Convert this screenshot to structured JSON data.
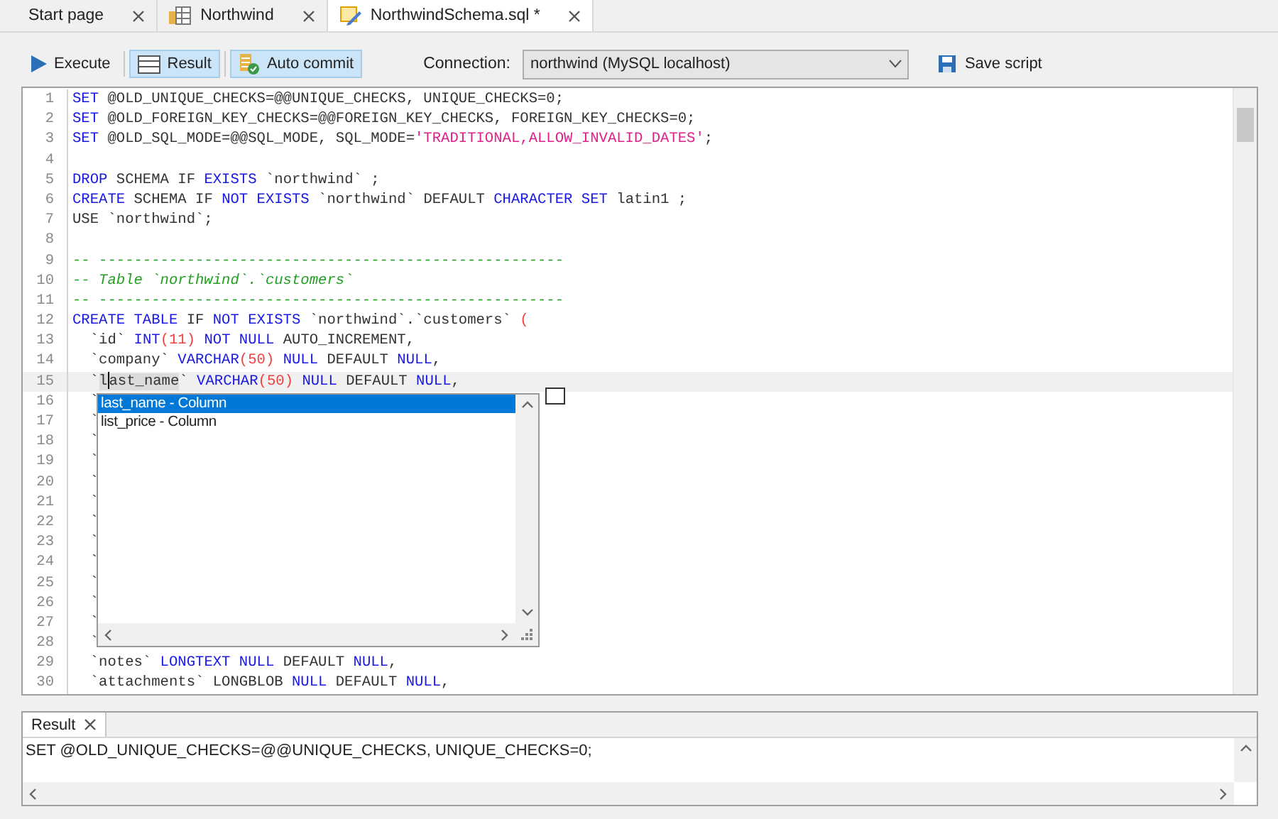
{
  "tabs": [
    {
      "label": "Start page",
      "kind": "page",
      "selected": false
    },
    {
      "label": "Northwind",
      "kind": "database",
      "selected": false
    },
    {
      "label": "NorthwindSchema.sql *",
      "kind": "script",
      "selected": true
    }
  ],
  "toolbar": {
    "buttons": [
      {
        "label": "Execute",
        "kind": "execute",
        "pressed": false
      },
      {
        "label": "Result",
        "kind": "result",
        "pressed": true
      },
      {
        "label": "Auto commit",
        "kind": "commit",
        "pressed": true
      }
    ],
    "connection": {
      "label": "Connection:",
      "value": "northwind (MySQL localhost)"
    },
    "save": {
      "label": "Save script"
    }
  },
  "editor": {
    "lines": [
      {
        "number": "1",
        "current": false,
        "tokens": [
          {
            "t": "SET",
            "kind": "kw"
          },
          {
            "t": " @OLD_UNIQUE_CHECKS=@@UNIQUE_CHECKS, UNIQUE_CHECKS=0;",
            "kind": "id"
          }
        ]
      },
      {
        "number": "2",
        "current": false,
        "tokens": [
          {
            "t": "SET",
            "kind": "kw"
          },
          {
            "t": " @OLD_FOREIGN_KEY_CHECKS=@@FOREIGN_KEY_CHECKS, FOREIGN_KEY_CHECKS=0;",
            "kind": "id"
          }
        ]
      },
      {
        "number": "3",
        "current": false,
        "tokens": [
          {
            "t": "SET",
            "kind": "kw"
          },
          {
            "t": " @OLD_SQL_MODE=@@SQL_MODE, SQL_MODE=",
            "kind": "id"
          },
          {
            "t": "'TRADITIONAL,ALLOW_INVALID_DATES'",
            "kind": "str"
          },
          {
            "t": ";",
            "kind": "id"
          }
        ]
      },
      {
        "number": "4",
        "current": false
      },
      {
        "number": "5",
        "current": false,
        "tokens": [
          {
            "t": "DROP",
            "kind": "kw"
          },
          {
            "t": " SCHEMA IF ",
            "kind": "id"
          },
          {
            "t": "EXISTS",
            "kind": "kw"
          },
          {
            "t": " `northwind` ;",
            "kind": "id"
          }
        ]
      },
      {
        "number": "6",
        "current": false,
        "tokens": [
          {
            "t": "CREATE",
            "kind": "kw"
          },
          {
            "t": " SCHEMA IF ",
            "kind": "id"
          },
          {
            "t": "NOT EXISTS",
            "kind": "kw"
          },
          {
            "t": " `northwind` DEFAULT ",
            "kind": "id"
          },
          {
            "t": "CHARACTER SET",
            "kind": "kw"
          },
          {
            "t": " latin1 ;",
            "kind": "id"
          }
        ]
      },
      {
        "number": "7",
        "current": false,
        "tokens": [
          {
            "t": "USE `northwind`;",
            "kind": "id"
          }
        ]
      },
      {
        "number": "8",
        "current": false
      },
      {
        "number": "9",
        "current": false,
        "tokens": [
          {
            "t": "-- -----------------------------------------------------",
            "kind": "cmt"
          }
        ]
      },
      {
        "number": "10",
        "current": false,
        "tokens": [
          {
            "t": "-- Table `northwind`.`customers`",
            "kind": "cmt"
          }
        ]
      },
      {
        "number": "11",
        "current": false,
        "tokens": [
          {
            "t": "-- -----------------------------------------------------",
            "kind": "cmt"
          }
        ]
      },
      {
        "number": "12",
        "current": false,
        "tokens": [
          {
            "t": "CREATE TABLE",
            "kind": "kw"
          },
          {
            "t": " IF ",
            "kind": "id"
          },
          {
            "t": "NOT EXISTS",
            "kind": "kw"
          },
          {
            "t": " `northwind`.`customers` ",
            "kind": "id"
          },
          {
            "t": "(",
            "kind": "num"
          }
        ]
      },
      {
        "number": "13",
        "current": false,
        "tokens": [
          {
            "t": "  `id` ",
            "kind": "id"
          },
          {
            "t": "INT",
            "kind": "kw"
          },
          {
            "t": "(11)",
            "kind": "num"
          },
          {
            "t": " NOT NULL",
            "kind": "kw"
          },
          {
            "t": " AUTO_INCREMENT,",
            "kind": "id"
          }
        ]
      },
      {
        "number": "14",
        "current": false,
        "tokens": [
          {
            "t": "  `company` ",
            "kind": "id"
          },
          {
            "t": "VARCHAR",
            "kind": "kw"
          },
          {
            "t": "(50)",
            "kind": "num"
          },
          {
            "t": " NULL",
            "kind": "kw"
          },
          {
            "t": " DEFAULT ",
            "kind": "id"
          },
          {
            "t": "NULL",
            "kind": "kw"
          },
          {
            "t": ",",
            "kind": "id"
          }
        ]
      },
      {
        "number": "15",
        "current": true,
        "tokens": [
          {
            "t": "  `",
            "kind": "id"
          },
          {
            "t": "last_name",
            "kind": "match"
          },
          {
            "t": "` ",
            "kind": "id"
          },
          {
            "t": "VARCHAR",
            "kind": "kw"
          },
          {
            "t": "(50)",
            "kind": "num"
          },
          {
            "t": " NULL",
            "kind": "kw"
          },
          {
            "t": " DEFAULT ",
            "kind": "id"
          },
          {
            "t": "NULL",
            "kind": "kw"
          },
          {
            "t": ",",
            "kind": "id"
          }
        ]
      },
      {
        "number": "16",
        "current": false,
        "tokens": [
          {
            "t": "  `",
            "kind": "id"
          }
        ]
      },
      {
        "number": "17",
        "current": false,
        "tokens": [
          {
            "t": "  `",
            "kind": "id"
          }
        ]
      },
      {
        "number": "18",
        "current": false,
        "tokens": [
          {
            "t": "  `",
            "kind": "id"
          }
        ]
      },
      {
        "number": "19",
        "current": false,
        "tokens": [
          {
            "t": "  `",
            "kind": "id"
          }
        ]
      },
      {
        "number": "20",
        "current": false,
        "tokens": [
          {
            "t": "  `",
            "kind": "id"
          }
        ]
      },
      {
        "number": "21",
        "current": false,
        "tokens": [
          {
            "t": "  `",
            "kind": "id"
          }
        ]
      },
      {
        "number": "22",
        "current": false,
        "tokens": [
          {
            "t": "  `",
            "kind": "id"
          }
        ]
      },
      {
        "number": "23",
        "current": false,
        "tokens": [
          {
            "t": "  `",
            "kind": "id"
          }
        ]
      },
      {
        "number": "24",
        "current": false,
        "tokens": [
          {
            "t": "  `",
            "kind": "id"
          }
        ]
      },
      {
        "number": "25",
        "current": false,
        "tokens": [
          {
            "t": "  `",
            "kind": "id"
          }
        ]
      },
      {
        "number": "26",
        "current": false,
        "tokens": [
          {
            "t": "  `",
            "kind": "id"
          }
        ]
      },
      {
        "number": "27",
        "current": false,
        "tokens": [
          {
            "t": "  `",
            "kind": "id"
          }
        ]
      },
      {
        "number": "28",
        "current": false,
        "tokens": [
          {
            "t": "  `",
            "kind": "id"
          }
        ]
      },
      {
        "number": "29",
        "current": false,
        "tokens": [
          {
            "t": "  `notes` ",
            "kind": "id"
          },
          {
            "t": "LONGTEXT",
            "kind": "kw"
          },
          {
            "t": " NULL",
            "kind": "kw"
          },
          {
            "t": " DEFAULT ",
            "kind": "id"
          },
          {
            "t": "NULL",
            "kind": "kw"
          },
          {
            "t": ",",
            "kind": "id"
          }
        ]
      },
      {
        "number": "30",
        "current": false,
        "tokens": [
          {
            "t": "  `attachments` LONGBLOB ",
            "kind": "id"
          },
          {
            "t": "NULL",
            "kind": "kw"
          },
          {
            "t": " DEFAULT ",
            "kind": "id"
          },
          {
            "t": "NULL",
            "kind": "kw"
          },
          {
            "t": ",",
            "kind": "id"
          }
        ]
      }
    ],
    "autocomplete": {
      "items": [
        {
          "label": "last_name - Column",
          "selected": true
        },
        {
          "label": "list_price - Column",
          "selected": false
        }
      ]
    }
  },
  "result": {
    "tab": "Result",
    "text": "SET @OLD_UNIQUE_CHECKS=@@UNIQUE_CHECKS, UNIQUE_CHECKS=0;"
  }
}
